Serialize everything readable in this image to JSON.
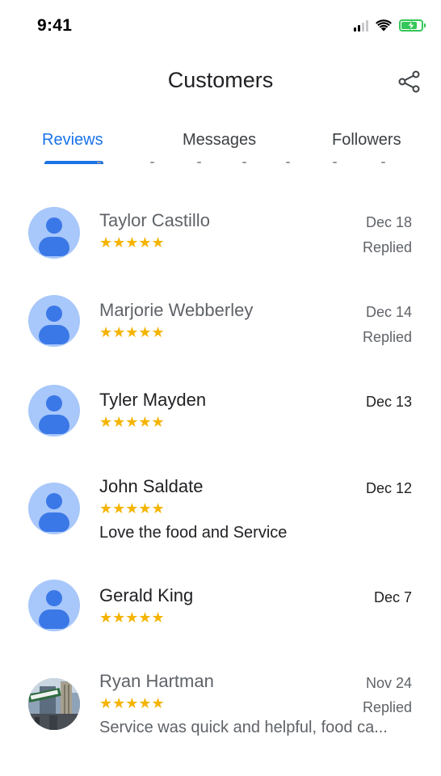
{
  "status_bar": {
    "time": "9:41"
  },
  "header": {
    "title": "Customers",
    "share_icon": "share-icon"
  },
  "tabs": [
    {
      "label": "Reviews",
      "active": true
    },
    {
      "label": "Messages",
      "active": false
    },
    {
      "label": "Followers",
      "active": false
    }
  ],
  "colors": {
    "accent": "#1a73e8",
    "star": "#f4b400",
    "avatar_bg": "#a8c7fa",
    "avatar_fg": "#3b78e7",
    "battery": "#34c759"
  },
  "reviews": [
    {
      "name": "Taylor Castillo",
      "stars": "★★★★★",
      "rating": 5,
      "date": "Dec 18",
      "status": "Replied",
      "snippet": ""
    },
    {
      "name": "Marjorie Webberley",
      "stars": "★★★★★",
      "rating": 5,
      "date": "Dec 14",
      "status": "Replied",
      "snippet": ""
    },
    {
      "name": "Tyler Mayden",
      "stars": "★★★★★",
      "rating": 5,
      "date": "Dec 13",
      "status": "",
      "snippet": ""
    },
    {
      "name": "John Saldate",
      "stars": "★★★★★",
      "rating": 5,
      "date": "Dec 12",
      "status": "",
      "snippet": "Love the food and Service"
    },
    {
      "name": "Gerald King",
      "stars": "★★★★★",
      "rating": 5,
      "date": "Dec 7",
      "status": "",
      "snippet": ""
    },
    {
      "name": "Ryan Hartman",
      "stars": "★★★★★",
      "rating": 5,
      "date": "Nov 24",
      "status": "Replied",
      "snippet": "Service was quick and helpful, food ca..."
    }
  ]
}
